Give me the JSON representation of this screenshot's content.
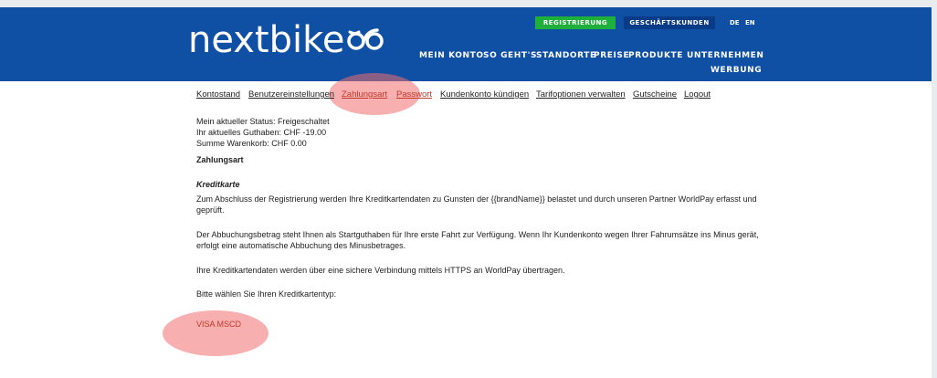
{
  "brand": {
    "name": "nextbike"
  },
  "topbar": {
    "register_label": "REGISTRIERUNG",
    "business_label": "GESCHÄFTSKUNDEN",
    "lang_de": "DE",
    "lang_en": "EN"
  },
  "main_nav": {
    "items": [
      "MEIN KONTO",
      "SO GEHT'S",
      "STANDORTE",
      "PREISE",
      "PRODUKTE",
      "UNTERNEHMEN",
      "WERBUNG"
    ]
  },
  "sub_nav": {
    "items": [
      "Kontostand",
      "Benutzereinstellungen",
      "Zahlungsart",
      "Passwort",
      "Kundenkonto kündigen",
      "Tarifoptionen verwalten",
      "Gutscheine",
      "Logout"
    ],
    "active": "Zahlungsart"
  },
  "status": {
    "status_line": "Mein aktueller Status: Freigeschaltet",
    "balance_line": "Ihr aktuelles Guthaben: CHF -19.00",
    "cart_line": "Summe Warenkorb: CHF 0.00"
  },
  "payment": {
    "heading": "Zahlungsart",
    "subheading": "Kreditkarte",
    "para1_line1": "Zum Abschluss der Registrierung werden Ihre Kreditkartendaten zu Gunsten der {{brandName}} belastet und durch unseren Partner WorldPay erfasst und",
    "para1_line2": "geprüft.",
    "para2_line1": "Der Abbuchungsbetrag steht Ihnen als Startguthaben für Ihre erste Fahrt zur Verfügung. Wenn Ihr Kundenkonto wegen Ihrer Fahrumsätze ins Minus gerät,",
    "para2_line2": "erfolgt eine automatische Abbuchung des Minusbetrages.",
    "para3": "Ihre Kreditkartendaten werden über eine sichere Verbindung mittels HTTPS an WorldPay übertragen.",
    "choose_label": "Bitte wählen Sie Ihren Kreditkartentyp:",
    "card_types": "VISA MSCD"
  },
  "colors": {
    "header_bg": "#0f4fa4",
    "register_bg": "#1fb03c",
    "business_bg": "#0a3b88",
    "highlight": "#f06e6e"
  }
}
